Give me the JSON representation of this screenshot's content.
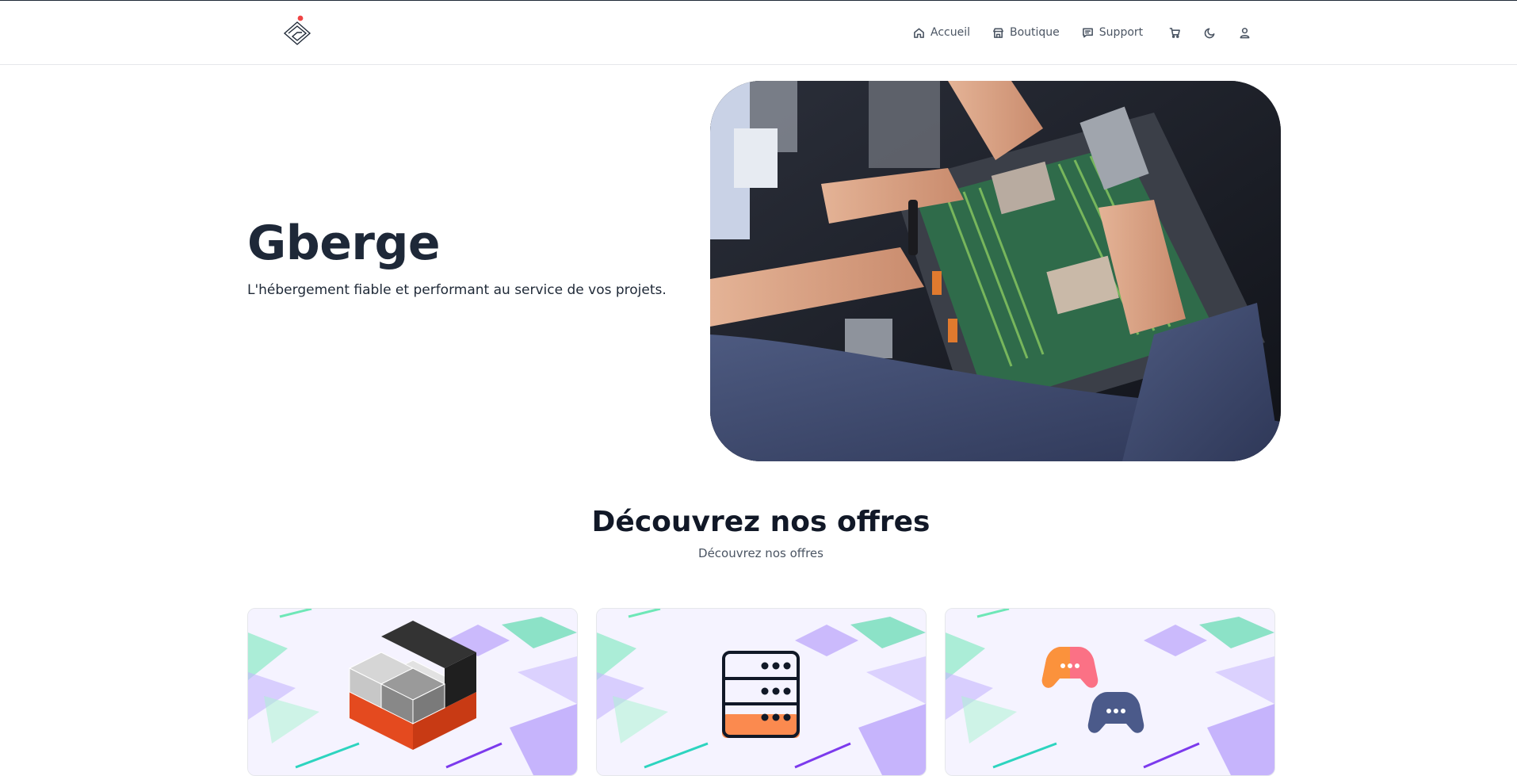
{
  "nav": {
    "home_label": "Accueil",
    "shop_label": "Boutique",
    "support_label": "Support"
  },
  "hero": {
    "title": "Gberge",
    "subtitle": "L'hébergement fiable et performant au service de vos projets."
  },
  "offers": {
    "title": "Découvrez nos offres",
    "subtitle": "Découvrez nos offres"
  },
  "colors": {
    "accent": "#ef4444",
    "text_dark": "#1e2838",
    "card_bg": "#f5f3ff",
    "mint": "#34d399",
    "violet": "#8b5cf6",
    "orange": "#f97346"
  },
  "icons": {
    "home": "home-icon",
    "shop": "store-icon",
    "support": "chat-icon",
    "cart": "cart-icon",
    "theme": "moon-icon",
    "account": "user-icon"
  }
}
